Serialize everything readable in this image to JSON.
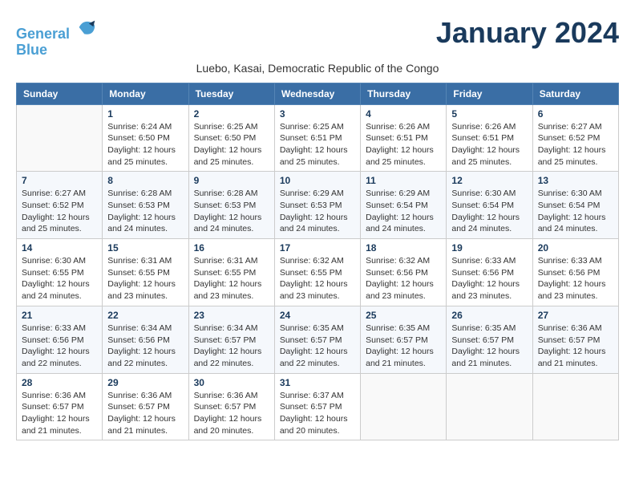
{
  "header": {
    "logo_line1": "General",
    "logo_line2": "Blue",
    "month_title": "January 2024",
    "subtitle": "Luebo, Kasai, Democratic Republic of the Congo"
  },
  "weekdays": [
    "Sunday",
    "Monday",
    "Tuesday",
    "Wednesday",
    "Thursday",
    "Friday",
    "Saturday"
  ],
  "weeks": [
    [
      {
        "day": "",
        "info": ""
      },
      {
        "day": "1",
        "info": "Sunrise: 6:24 AM\nSunset: 6:50 PM\nDaylight: 12 hours\nand 25 minutes."
      },
      {
        "day": "2",
        "info": "Sunrise: 6:25 AM\nSunset: 6:50 PM\nDaylight: 12 hours\nand 25 minutes."
      },
      {
        "day": "3",
        "info": "Sunrise: 6:25 AM\nSunset: 6:51 PM\nDaylight: 12 hours\nand 25 minutes."
      },
      {
        "day": "4",
        "info": "Sunrise: 6:26 AM\nSunset: 6:51 PM\nDaylight: 12 hours\nand 25 minutes."
      },
      {
        "day": "5",
        "info": "Sunrise: 6:26 AM\nSunset: 6:51 PM\nDaylight: 12 hours\nand 25 minutes."
      },
      {
        "day": "6",
        "info": "Sunrise: 6:27 AM\nSunset: 6:52 PM\nDaylight: 12 hours\nand 25 minutes."
      }
    ],
    [
      {
        "day": "7",
        "info": "Sunrise: 6:27 AM\nSunset: 6:52 PM\nDaylight: 12 hours\nand 25 minutes."
      },
      {
        "day": "8",
        "info": "Sunrise: 6:28 AM\nSunset: 6:53 PM\nDaylight: 12 hours\nand 24 minutes."
      },
      {
        "day": "9",
        "info": "Sunrise: 6:28 AM\nSunset: 6:53 PM\nDaylight: 12 hours\nand 24 minutes."
      },
      {
        "day": "10",
        "info": "Sunrise: 6:29 AM\nSunset: 6:53 PM\nDaylight: 12 hours\nand 24 minutes."
      },
      {
        "day": "11",
        "info": "Sunrise: 6:29 AM\nSunset: 6:54 PM\nDaylight: 12 hours\nand 24 minutes."
      },
      {
        "day": "12",
        "info": "Sunrise: 6:30 AM\nSunset: 6:54 PM\nDaylight: 12 hours\nand 24 minutes."
      },
      {
        "day": "13",
        "info": "Sunrise: 6:30 AM\nSunset: 6:54 PM\nDaylight: 12 hours\nand 24 minutes."
      }
    ],
    [
      {
        "day": "14",
        "info": "Sunrise: 6:30 AM\nSunset: 6:55 PM\nDaylight: 12 hours\nand 24 minutes."
      },
      {
        "day": "15",
        "info": "Sunrise: 6:31 AM\nSunset: 6:55 PM\nDaylight: 12 hours\nand 23 minutes."
      },
      {
        "day": "16",
        "info": "Sunrise: 6:31 AM\nSunset: 6:55 PM\nDaylight: 12 hours\nand 23 minutes."
      },
      {
        "day": "17",
        "info": "Sunrise: 6:32 AM\nSunset: 6:55 PM\nDaylight: 12 hours\nand 23 minutes."
      },
      {
        "day": "18",
        "info": "Sunrise: 6:32 AM\nSunset: 6:56 PM\nDaylight: 12 hours\nand 23 minutes."
      },
      {
        "day": "19",
        "info": "Sunrise: 6:33 AM\nSunset: 6:56 PM\nDaylight: 12 hours\nand 23 minutes."
      },
      {
        "day": "20",
        "info": "Sunrise: 6:33 AM\nSunset: 6:56 PM\nDaylight: 12 hours\nand 23 minutes."
      }
    ],
    [
      {
        "day": "21",
        "info": "Sunrise: 6:33 AM\nSunset: 6:56 PM\nDaylight: 12 hours\nand 22 minutes."
      },
      {
        "day": "22",
        "info": "Sunrise: 6:34 AM\nSunset: 6:56 PM\nDaylight: 12 hours\nand 22 minutes."
      },
      {
        "day": "23",
        "info": "Sunrise: 6:34 AM\nSunset: 6:57 PM\nDaylight: 12 hours\nand 22 minutes."
      },
      {
        "day": "24",
        "info": "Sunrise: 6:35 AM\nSunset: 6:57 PM\nDaylight: 12 hours\nand 22 minutes."
      },
      {
        "day": "25",
        "info": "Sunrise: 6:35 AM\nSunset: 6:57 PM\nDaylight: 12 hours\nand 21 minutes."
      },
      {
        "day": "26",
        "info": "Sunrise: 6:35 AM\nSunset: 6:57 PM\nDaylight: 12 hours\nand 21 minutes."
      },
      {
        "day": "27",
        "info": "Sunrise: 6:36 AM\nSunset: 6:57 PM\nDaylight: 12 hours\nand 21 minutes."
      }
    ],
    [
      {
        "day": "28",
        "info": "Sunrise: 6:36 AM\nSunset: 6:57 PM\nDaylight: 12 hours\nand 21 minutes."
      },
      {
        "day": "29",
        "info": "Sunrise: 6:36 AM\nSunset: 6:57 PM\nDaylight: 12 hours\nand 21 minutes."
      },
      {
        "day": "30",
        "info": "Sunrise: 6:36 AM\nSunset: 6:57 PM\nDaylight: 12 hours\nand 20 minutes."
      },
      {
        "day": "31",
        "info": "Sunrise: 6:37 AM\nSunset: 6:57 PM\nDaylight: 12 hours\nand 20 minutes."
      },
      {
        "day": "",
        "info": ""
      },
      {
        "day": "",
        "info": ""
      },
      {
        "day": "",
        "info": ""
      }
    ]
  ]
}
